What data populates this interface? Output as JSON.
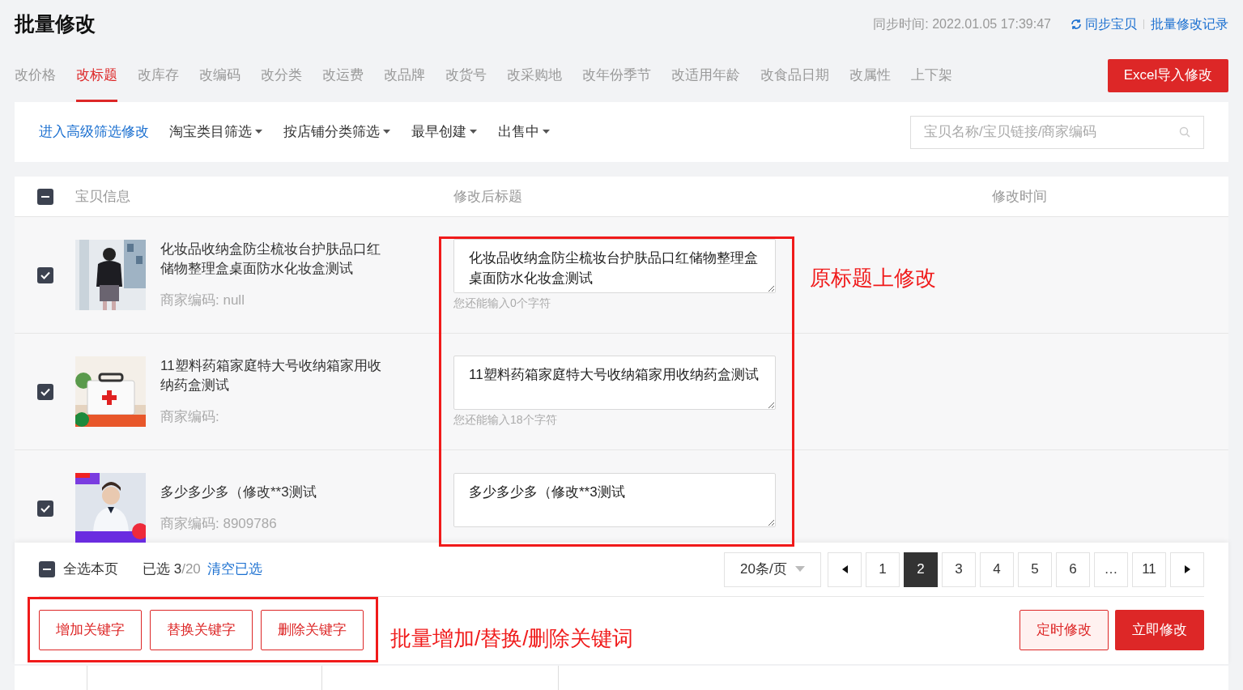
{
  "page": {
    "title": "批量修改",
    "sync_time": "同步时间: 2022.01.05 17:39:47",
    "sync_link": "同步宝贝",
    "history_link": "批量修改记录"
  },
  "tabs": [
    {
      "label": "改价格",
      "selected": false
    },
    {
      "label": "改标题",
      "selected": true
    },
    {
      "label": "改库存",
      "selected": false
    },
    {
      "label": "改编码",
      "selected": false
    },
    {
      "label": "改分类",
      "selected": false
    },
    {
      "label": "改运费",
      "selected": false
    },
    {
      "label": "改品牌",
      "selected": false
    },
    {
      "label": "改货号",
      "selected": false
    },
    {
      "label": "改采购地",
      "selected": false
    },
    {
      "label": "改年份季节",
      "selected": false
    },
    {
      "label": "改适用年龄",
      "selected": false
    },
    {
      "label": "改食品日期",
      "selected": false
    },
    {
      "label": "改属性",
      "selected": false
    },
    {
      "label": "上下架",
      "selected": false
    }
  ],
  "import_button": "Excel导入修改",
  "filters": {
    "advanced_link": "进入高级筛选修改",
    "dropdowns": [
      "淘宝类目筛选",
      "按店铺分类筛选",
      "最早创建",
      "出售中"
    ],
    "search": {
      "placeholder": "宝贝名称/宝贝链接/商家编码"
    }
  },
  "table": {
    "header_indeterminate": true,
    "columns": [
      "宝贝信息",
      "修改后标题",
      "修改时间"
    ],
    "rows": [
      {
        "checked": true,
        "title": "化妆品收纳盒防尘梳妆台护肤品口红储物整理盒桌面防水化妆盒测试",
        "code": "商家编码: null",
        "new_title": "化妆品收纳盒防尘梳妆台护肤品口红储物整理盒桌面防水化妆盒测试",
        "hint": "您还能输入0个字符"
      },
      {
        "checked": true,
        "title": "11塑料药箱家庭特大号收纳箱家用收纳药盒测试",
        "code": "商家编码:",
        "new_title": "11塑料药箱家庭特大号收纳箱家用收纳药盒测试",
        "hint": "您还能输入18个字符"
      },
      {
        "checked": true,
        "title": "多少多少多（修改**3测试",
        "code": "商家编码: 8909786",
        "new_title": "多少多少多（修改**3测试"
      }
    ]
  },
  "footer": {
    "select_page_label": "全选本页",
    "select_page_indeterminate": true,
    "selected_text": "已选 3",
    "total_text": "/20",
    "clear_link": "清空已选",
    "page_size": "20条/页",
    "pages": [
      {
        "kind": "prev",
        "selected": false
      },
      {
        "kind": "number",
        "label": "1",
        "selected": false
      },
      {
        "kind": "number",
        "label": "2",
        "selected": true
      },
      {
        "kind": "number",
        "label": "3",
        "selected": false
      },
      {
        "kind": "number",
        "label": "4",
        "selected": false
      },
      {
        "kind": "number",
        "label": "5",
        "selected": false
      },
      {
        "kind": "number",
        "label": "6",
        "selected": false
      },
      {
        "kind": "number",
        "label": "…",
        "selected": false
      },
      {
        "kind": "number",
        "label": "11",
        "selected": false
      },
      {
        "kind": "next",
        "selected": false
      }
    ],
    "keyword_buttons": [
      "增加关键字",
      "替换关键字",
      "删除关键字"
    ],
    "schedule_button": "定时修改",
    "apply_button": "立即修改"
  },
  "annotations": [
    "原标题上修改",
    "批量增加/替换/删除关键词"
  ]
}
